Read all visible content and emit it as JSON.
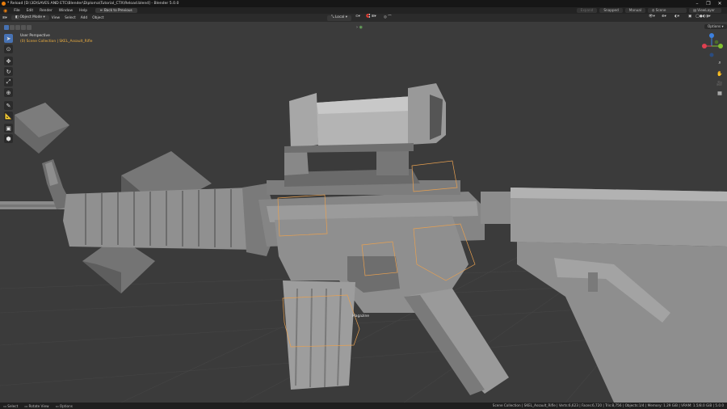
{
  "window": {
    "title": "* Reload [D:\\3D\\SAVES AND ETC\\Blender\\Diploma\\Tutorial_CTX\\Reload.blend] - Blender 5.0.0"
  },
  "menu": {
    "items": [
      "File",
      "Edit",
      "Render",
      "Window",
      "Help"
    ],
    "back_button": "Back to Previous"
  },
  "top_right": {
    "expand": "Expand",
    "snapped": "Snapped",
    "manual": "Manual",
    "scene": "Scene",
    "viewlayer": "ViewLayer"
  },
  "header": {
    "mode": "Object Mode",
    "items": [
      "View",
      "Select",
      "Add",
      "Object"
    ],
    "transform_orientation": "Local",
    "options": "Options"
  },
  "viewport": {
    "perspective": "User Perspective",
    "collection": "(0) Scene Collection | SKEL_Assault_Rifle",
    "magazine_label": "Magazine"
  },
  "status": {
    "select": "Select",
    "rotate": "Rotate View",
    "options": "Options",
    "stats": "Scene Collection | SKEL_Assault_Rifle | Verts:6,623 | Faces:6,720 | Tris:8,756 | Objects:1/4 | Memory: 1.29 GiB | VRAM: 1.5/8.0 GiB | 5.0.0"
  },
  "colors": {
    "accent": "#4772b3",
    "selection": "#e8a050",
    "collection_text": "#f0b040",
    "x_axis": "#e04050",
    "y_axis": "#80c030",
    "z_axis": "#3c80e0"
  }
}
